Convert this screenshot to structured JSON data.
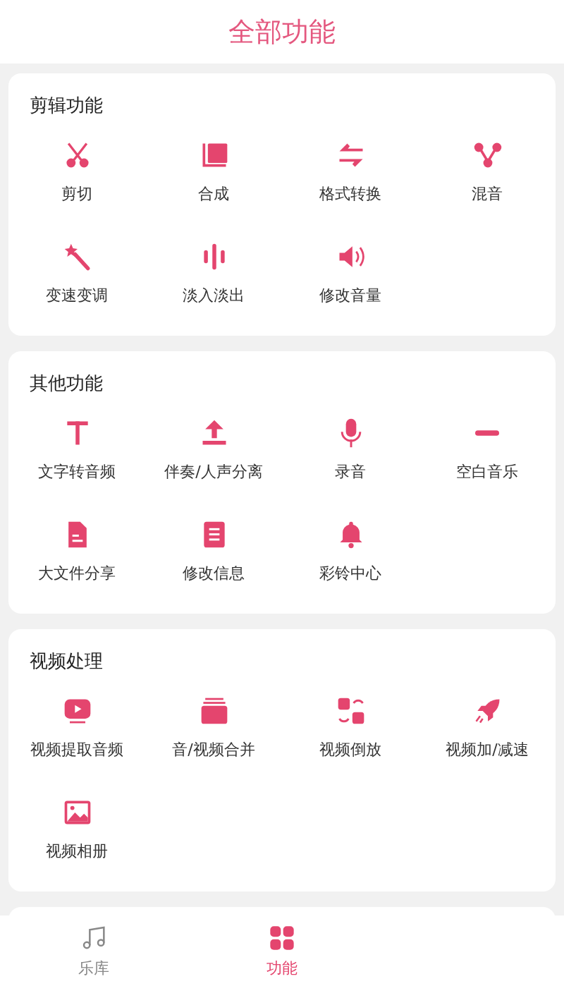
{
  "header": {
    "title": "全部功能"
  },
  "sections": [
    {
      "title": "剪辑功能",
      "items": [
        {
          "label": "剪切"
        },
        {
          "label": "合成"
        },
        {
          "label": "格式转换"
        },
        {
          "label": "混音"
        },
        {
          "label": "变速变调"
        },
        {
          "label": "淡入淡出"
        },
        {
          "label": "修改音量"
        }
      ]
    },
    {
      "title": "其他功能",
      "items": [
        {
          "label": "文字转音频"
        },
        {
          "label": "伴奏/人声分离"
        },
        {
          "label": "录音"
        },
        {
          "label": "空白音乐"
        },
        {
          "label": "大文件分享"
        },
        {
          "label": "修改信息"
        },
        {
          "label": "彩铃中心"
        }
      ]
    },
    {
      "title": "视频处理",
      "items": [
        {
          "label": "视频提取音频"
        },
        {
          "label": "音/视频合并"
        },
        {
          "label": "视频倒放"
        },
        {
          "label": "视频加/减速"
        },
        {
          "label": "视频相册"
        }
      ]
    }
  ],
  "tabs": [
    {
      "label": "乐库",
      "selected": false
    },
    {
      "label": "功能",
      "selected": true
    }
  ]
}
